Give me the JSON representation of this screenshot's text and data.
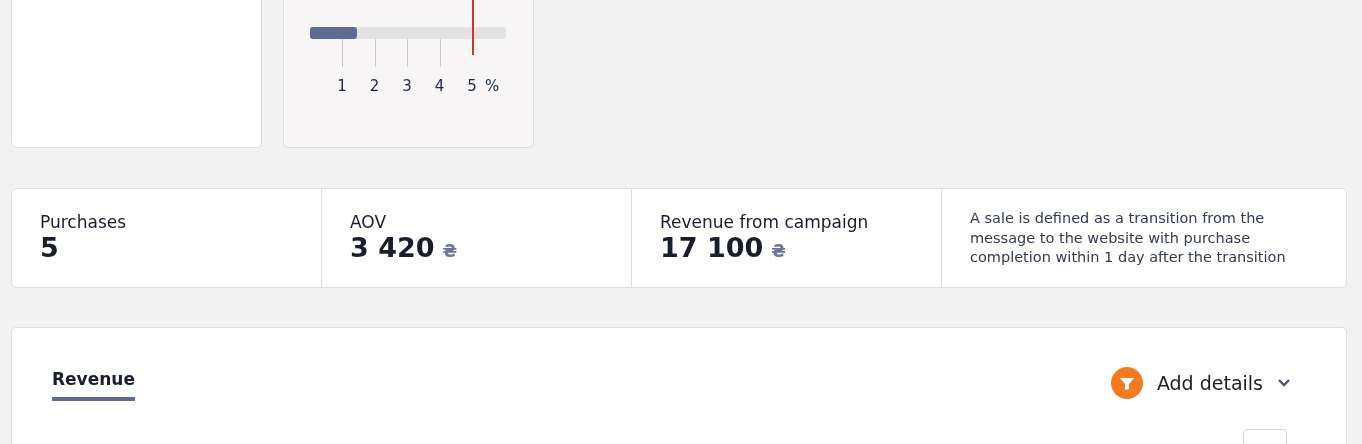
{
  "scale": {
    "level": 0.24,
    "ticks": [
      {
        "label": "1",
        "selected": false
      },
      {
        "label": "2",
        "selected": false
      },
      {
        "label": "3",
        "selected": false
      },
      {
        "label": "4",
        "selected": false
      },
      {
        "label": "5",
        "selected": true
      }
    ],
    "unit": "%"
  },
  "stats": [
    {
      "label": "Purchases",
      "value": "5"
    },
    {
      "label": "AOV",
      "value": "3 420",
      "currency": "₴"
    },
    {
      "label": "Revenue from campaign",
      "value": "17 100",
      "currency": "₴"
    }
  ],
  "note": "A sale is defined as a transition from the message to the website with purchase completion within 1 day after the transition",
  "tabs": [
    {
      "label": "Revenue",
      "selected": true
    }
  ],
  "add_details": {
    "label": "Add details"
  }
}
